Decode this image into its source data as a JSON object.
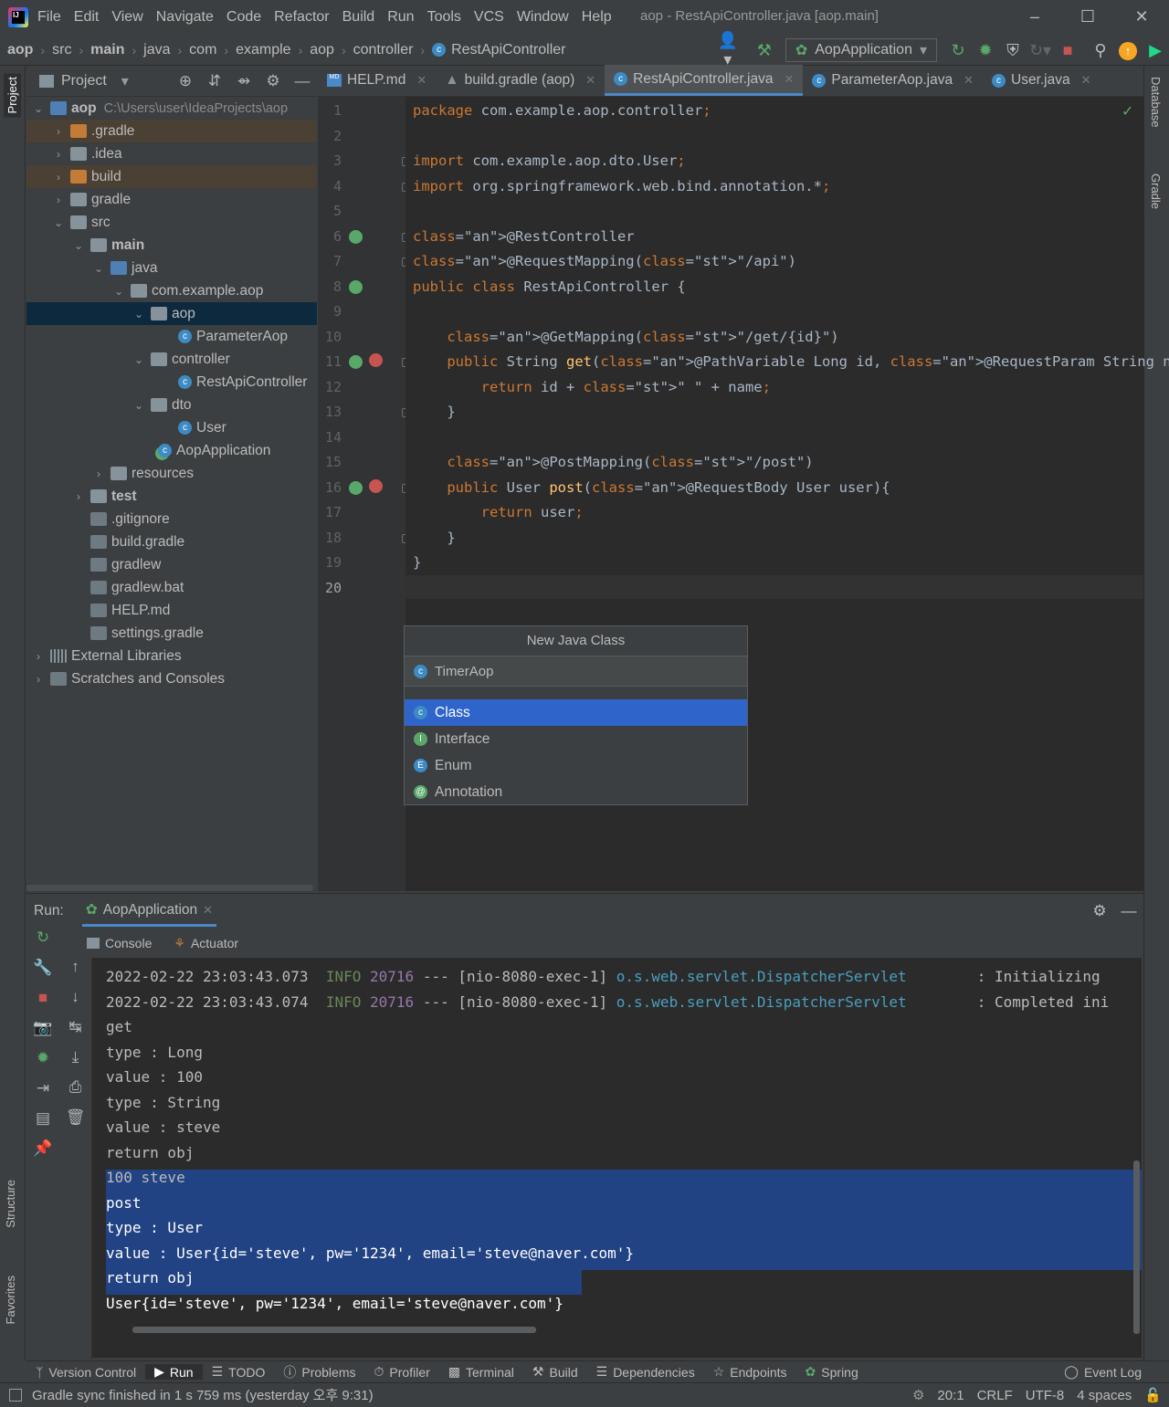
{
  "menu": {
    "items": [
      "File",
      "Edit",
      "View",
      "Navigate",
      "Code",
      "Refactor",
      "Build",
      "Run",
      "Tools",
      "VCS",
      "Window",
      "Help"
    ],
    "window_title": "aop - RestApiController.java [aop.main]"
  },
  "breadcrumb": [
    "aop",
    "src",
    "main",
    "java",
    "com",
    "example",
    "aop",
    "controller",
    "RestApiController"
  ],
  "toolbar": {
    "run_config": "AopApplication"
  },
  "left_stripe": {
    "project": "Project",
    "structure": "Structure",
    "favorites": "Favorites"
  },
  "right_stripe": {
    "database": "Database",
    "gradle": "Gradle"
  },
  "project_panel": {
    "title": "Project",
    "root_name": "aop",
    "root_path": "C:\\Users\\user\\IdeaProjects\\aop",
    "nodes": [
      ".gradle",
      ".idea",
      "build",
      "gradle",
      "src",
      "main",
      "java",
      "com.example.aop",
      "aop",
      "ParameterAop",
      "controller",
      "RestApiController",
      "dto",
      "User",
      "AopApplication",
      "resources",
      "test",
      ".gitignore",
      "build.gradle",
      "gradlew",
      "gradlew.bat",
      "HELP.md",
      "settings.gradle",
      "External Libraries",
      "Scratches and Consoles"
    ]
  },
  "editor": {
    "tabs": [
      "HELP.md",
      "build.gradle (aop)",
      "RestApiController.java",
      "ParameterAop.java",
      "User.java"
    ],
    "active_tab": "RestApiController.java",
    "current_line": "20",
    "lines": [
      "package com.example.aop.controller;",
      "",
      "import com.example.aop.dto.User;",
      "import org.springframework.web.bind.annotation.*;",
      "",
      "@RestController",
      "@RequestMapping(\"/api\")",
      "public class RestApiController {",
      "",
      "    @GetMapping(\"/get/{id}\")",
      "    public String get(@PathVariable Long id, @RequestParam String name){",
      "        return id + \" \" + name;",
      "    }",
      "",
      "    @PostMapping(\"/post\")",
      "    public User post(@RequestBody User user){",
      "        return user;",
      "    }",
      "}",
      ""
    ]
  },
  "new_class_popup": {
    "title": "New Java Class",
    "input_value": "TimerAop",
    "options": [
      "Class",
      "Interface",
      "Enum",
      "Annotation"
    ],
    "selected": "Class"
  },
  "run_panel": {
    "label": "Run:",
    "config_tab": "AopApplication",
    "tabs": [
      "Console",
      "Actuator"
    ],
    "log": [
      {
        "date": "2022-02-22 23:03:43.073",
        "level": "INFO",
        "pid": "20716",
        "sep": "---",
        "thread": "[nio-8080-exec-1]",
        "cls": "o.s.web.servlet.DispatcherServlet",
        "msg": ": Initializing"
      },
      {
        "date": "2022-02-22 23:03:43.074",
        "level": "INFO",
        "pid": "20716",
        "sep": "---",
        "thread": "[nio-8080-exec-1]",
        "cls": "o.s.web.servlet.DispatcherServlet",
        "msg": ": Completed ini"
      }
    ],
    "output": [
      "get",
      "type : Long",
      "value : 100",
      "type : String",
      "value : steve",
      "return obj",
      "100 steve",
      "post",
      "type : User",
      "value : User{id='steve', pw='1234', email='steve@naver.com'}",
      "return obj",
      "User{id='steve', pw='1234', email='steve@naver.com'}"
    ]
  },
  "bottom_tabs": [
    "Version Control",
    "Run",
    "TODO",
    "Problems",
    "Profiler",
    "Terminal",
    "Build",
    "Dependencies",
    "Endpoints",
    "Spring",
    "Event Log"
  ],
  "status": {
    "message": "Gradle sync finished in 1 s 759 ms (yesterday 오후 9:31)",
    "position": "20:1",
    "line_sep": "CRLF",
    "encoding": "UTF-8",
    "indent": "4 spaces"
  }
}
